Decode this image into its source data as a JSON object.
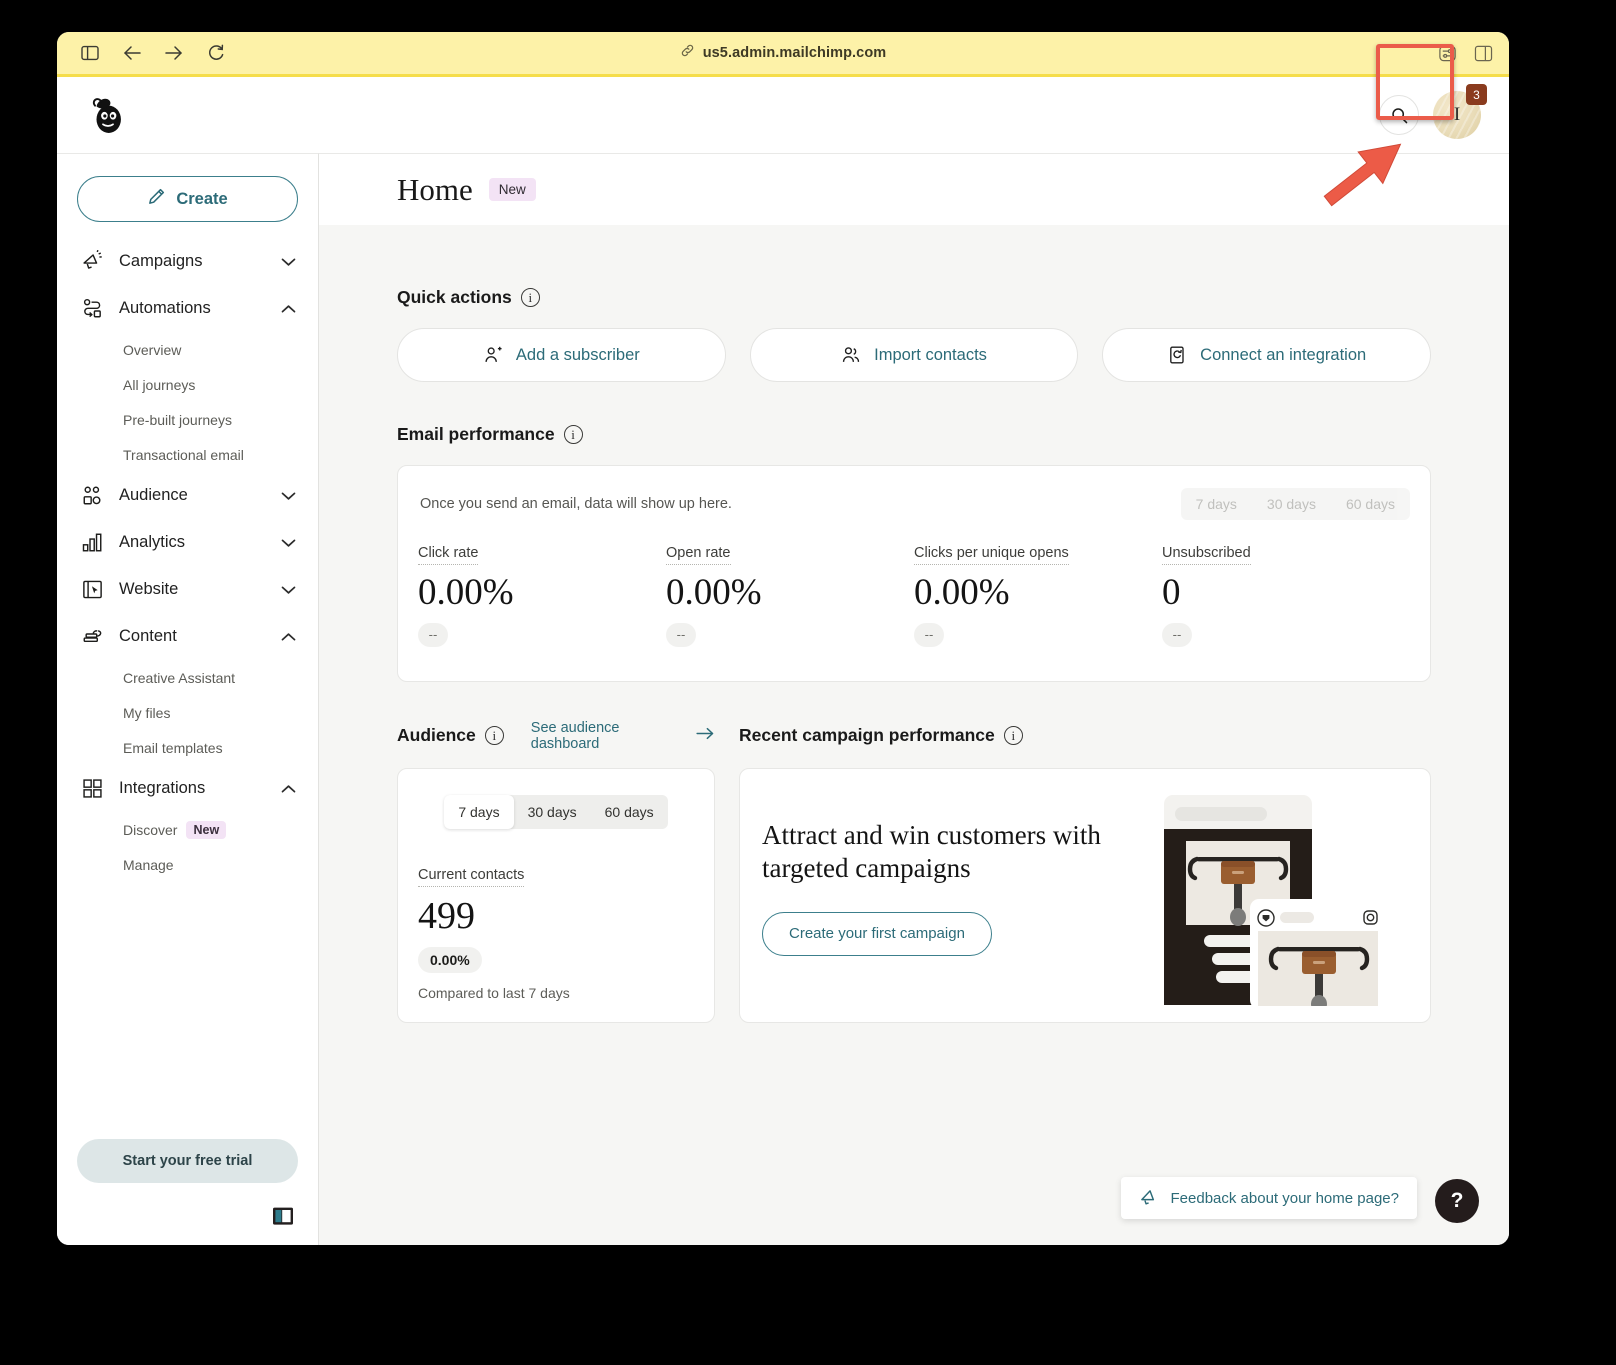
{
  "browser": {
    "url": "us5.admin.mailchimp.com",
    "link_icon": "link-icon",
    "sidebar_toggle_icon": "sidebar-toggle-icon",
    "back_icon": "back-arrow-icon",
    "forward_icon": "forward-arrow-icon",
    "reload_icon": "reload-icon",
    "extensions_icon": "extensions-icon",
    "panel_icon": "panel-toggle-icon"
  },
  "topbar": {
    "logo": "mailchimp-logo",
    "search_icon": "search-icon",
    "avatar_initial": "I",
    "avatar_badge": "3"
  },
  "sidebar": {
    "create_label": "Create",
    "create_icon": "pencil-icon",
    "items": [
      {
        "label": "Campaigns",
        "icon": "megaphone-icon",
        "expanded": false,
        "chevron": "chevron-down"
      },
      {
        "label": "Automations",
        "icon": "automations-icon",
        "expanded": true,
        "chevron": "chevron-up"
      },
      {
        "label": "Audience",
        "icon": "audience-icon",
        "expanded": false,
        "chevron": "chevron-down"
      },
      {
        "label": "Analytics",
        "icon": "bar-chart-icon",
        "expanded": false,
        "chevron": "chevron-down"
      },
      {
        "label": "Website",
        "icon": "website-icon",
        "expanded": false,
        "chevron": "chevron-down"
      },
      {
        "label": "Content",
        "icon": "content-icon",
        "expanded": true,
        "chevron": "chevron-up"
      },
      {
        "label": "Integrations",
        "icon": "grid-icon",
        "expanded": true,
        "chevron": "chevron-up"
      }
    ],
    "automations_sub": [
      "Overview",
      "All journeys",
      "Pre-built journeys",
      "Transactional email"
    ],
    "content_sub": [
      "Creative Assistant",
      "My files",
      "Email templates"
    ],
    "integrations_sub": [
      {
        "label": "Discover",
        "badge": "New"
      },
      {
        "label": "Manage",
        "badge": ""
      }
    ],
    "trial_label": "Start your free trial",
    "collapse_icon": "collapse-sidebar-icon"
  },
  "page": {
    "title": "Home",
    "badge": "New"
  },
  "quick_actions": {
    "heading": "Quick actions",
    "info_icon": "info-icon",
    "cards": [
      {
        "label": "Add a subscriber",
        "icon": "add-person-icon"
      },
      {
        "label": "Import contacts",
        "icon": "people-icon"
      },
      {
        "label": "Connect an integration",
        "icon": "integration-icon"
      }
    ]
  },
  "email_performance": {
    "heading": "Email performance",
    "info_icon": "info-icon",
    "empty_message": "Once you send an email, data will show up here.",
    "range_options": [
      "7 days",
      "30 days",
      "60 days"
    ],
    "range_selected": "7 days",
    "metrics": [
      {
        "label": "Click rate",
        "value": "0.00%",
        "delta": "--"
      },
      {
        "label": "Open rate",
        "value": "0.00%",
        "delta": "--"
      },
      {
        "label": "Clicks per unique opens",
        "value": "0.00%",
        "delta": "--"
      },
      {
        "label": "Unsubscribed",
        "value": "0",
        "delta": "--"
      }
    ]
  },
  "audience": {
    "heading": "Audience",
    "info_icon": "info-icon",
    "dashboard_link": "See audience dashboard",
    "arrow_icon": "arrow-right-icon",
    "range_options": [
      "7 days",
      "30 days",
      "60 days"
    ],
    "range_selected": "7 days",
    "contacts_label": "Current contacts",
    "contacts_value": "499",
    "delta": "0.00%",
    "compare_text": "Compared to last 7 days"
  },
  "recent_campaign": {
    "heading": "Recent campaign performance",
    "info_icon": "info-icon",
    "promo_title": "Attract and win customers with targeted campaigns",
    "promo_button": "Create your first campaign",
    "promo_art": "email-and-social-preview-illustration"
  },
  "footer": {
    "feedback_label": "Feedback about your home page?",
    "feedback_icon": "megaphone-icon",
    "help_label": "?"
  },
  "annotation": {
    "highlight_target": "avatar",
    "arrow_icon": "red-pointer-arrow",
    "highlight_color": "#eb5c4a"
  }
}
